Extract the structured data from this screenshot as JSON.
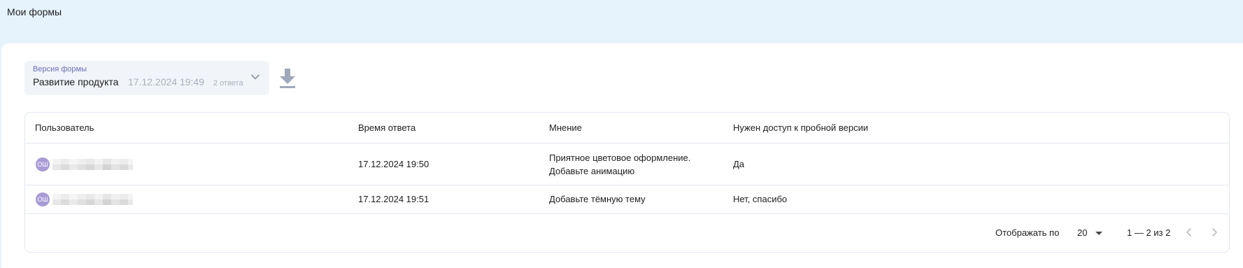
{
  "header": {
    "title": "Мои формы"
  },
  "version_select": {
    "caption": "Версия формы",
    "form_name": "Развитие продукта",
    "date": "17.12.2024 19:49",
    "answers_count": "2 ответа",
    "icon": "chevron-down-icon"
  },
  "toolbar": {
    "download_icon": "download-icon"
  },
  "table": {
    "columns": [
      "Пользователь",
      "Время ответа",
      "Мнение",
      "Нужен доступ к пробной версии"
    ],
    "rows": [
      {
        "avatar_initials": "ОШ",
        "time": "17.12.2024 19:50",
        "opinion_line1": "Приятное цветовое оформление.",
        "opinion_line2": "Добавьте анимацию",
        "access": "Да"
      },
      {
        "avatar_initials": "ОШ",
        "time": "17.12.2024 19:51",
        "opinion_line1": "Добавьте тёмную тему",
        "access": "Нет, спасибо"
      }
    ]
  },
  "pagination": {
    "show_label": "Отображать по",
    "page_size": "20",
    "range": "1 — 2 из 2",
    "prev_icon": "chevron-left-icon",
    "next_icon": "chevron-right-icon"
  },
  "colors": {
    "header_bg": "#e6f3fd",
    "avatar_bg": "#a89bd6",
    "caption_accent": "#6d6fb8",
    "muted_text": "#a9b0bd",
    "border": "#e1e6ef"
  }
}
